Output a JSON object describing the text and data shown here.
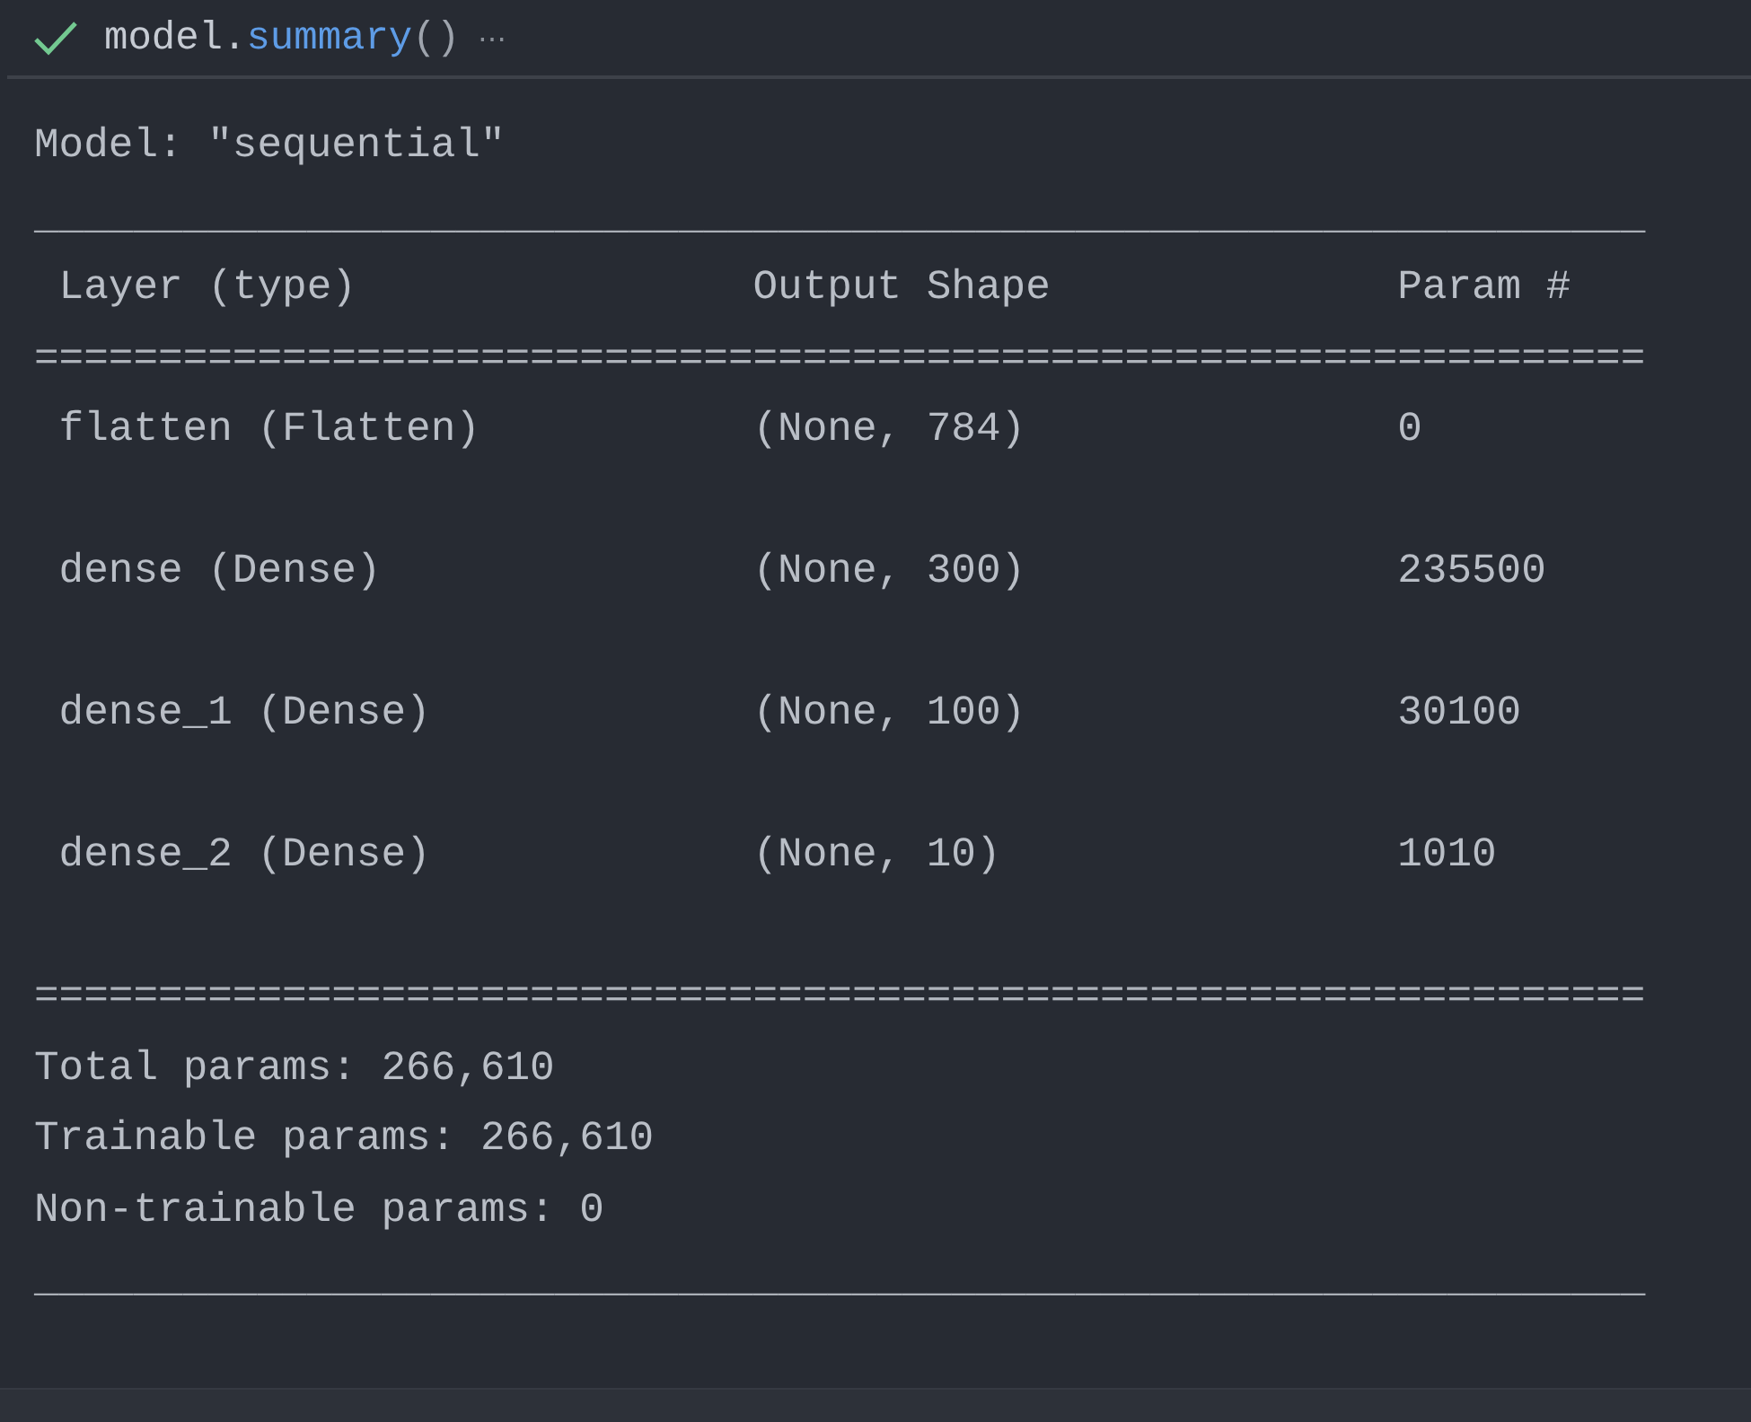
{
  "cell": {
    "succeeded": true,
    "code": [
      {
        "text": "model.",
        "kind": "plain"
      },
      {
        "text": "summary",
        "kind": "function"
      },
      {
        "text": "()",
        "kind": "punct"
      }
    ],
    "more": "⋯"
  },
  "output": {
    "title": "Model: \"sequential\"",
    "rule_top": "_________________________________________________________________",
    "columns": [
      "Layer (type)",
      "Output Shape",
      "Param #"
    ],
    "rule_header": "=================================================================",
    "rows": [
      {
        "layer": "flatten (Flatten)",
        "output_shape": "(None, 784)",
        "params": "0"
      },
      {
        "layer": "dense (Dense)",
        "output_shape": "(None, 300)",
        "params": "235500"
      },
      {
        "layer": "dense_1 (Dense)",
        "output_shape": "(None, 100)",
        "params": "30100"
      },
      {
        "layer": "dense_2 (Dense)",
        "output_shape": "(None, 10)",
        "params": "1010"
      }
    ],
    "rule_bottom": "=================================================================",
    "totals": [
      "Total params: 266,610",
      "Trainable params: 266,610",
      "Non-trainable params: 0"
    ],
    "rule_end": "_________________________________________________________________"
  }
}
